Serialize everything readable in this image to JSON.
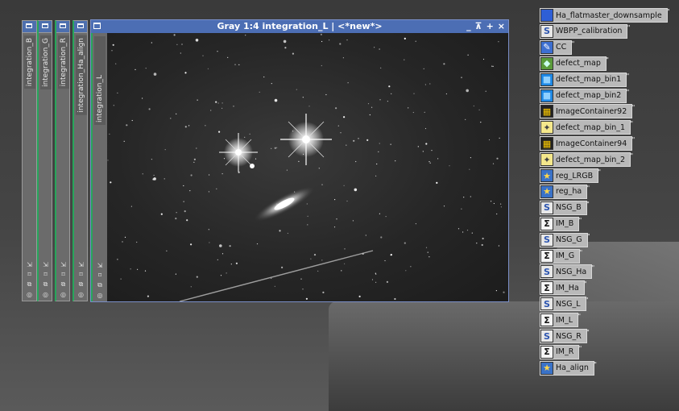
{
  "side_windows": [
    {
      "label": "integration_B"
    },
    {
      "label": "integration_G"
    },
    {
      "label": "integration_R"
    },
    {
      "label": "integration_Ha_align"
    }
  ],
  "main_window": {
    "title": "Gray 1:4 integration_L | <*new*>",
    "side_label": "integration_L",
    "controls": [
      "_",
      "⊼",
      "+",
      "×"
    ]
  },
  "tool_glyphs": [
    "⇲",
    "⌑",
    "⧉",
    "◎"
  ],
  "icons": [
    {
      "label": "Ha_flatmaster_downsample",
      "icon": "image-window-icon"
    },
    {
      "label": "WBPP_calibration",
      "icon": "process-container-icon"
    },
    {
      "label": "CC",
      "icon": "cosmetic-correction-icon"
    },
    {
      "label": "defect_map",
      "icon": "defect-map-icon"
    },
    {
      "label": "defect_map_bin1",
      "icon": "cube-icon"
    },
    {
      "label": "defect_map_bin2",
      "icon": "cube-icon"
    },
    {
      "label": "ImageContainer92",
      "icon": "image-container-icon"
    },
    {
      "label": "defect_map_bin_1",
      "icon": "script-icon"
    },
    {
      "label": "ImageContainer94",
      "icon": "image-container-icon"
    },
    {
      "label": "defect_map_bin_2",
      "icon": "script-icon"
    },
    {
      "label": "reg_LRGB",
      "icon": "star-alignment-icon"
    },
    {
      "label": "reg_ha",
      "icon": "star-alignment-icon"
    },
    {
      "label": "NSG_B",
      "icon": "process-container-icon"
    },
    {
      "label": "IM_B",
      "icon": "sigma-icon"
    },
    {
      "label": "NSG_G",
      "icon": "process-container-icon"
    },
    {
      "label": "IM_G",
      "icon": "sigma-icon"
    },
    {
      "label": "NSG_Ha",
      "icon": "process-container-icon"
    },
    {
      "label": "IM_Ha",
      "icon": "sigma-icon"
    },
    {
      "label": "NSG_L",
      "icon": "process-container-icon"
    },
    {
      "label": "IM_L",
      "icon": "sigma-icon"
    },
    {
      "label": "NSG_R",
      "icon": "process-container-icon"
    },
    {
      "label": "IM_R",
      "icon": "sigma-icon"
    },
    {
      "label": "Ha_align",
      "icon": "star-alignment-icon"
    }
  ],
  "colors": {
    "title_bar": "#4c6eb4",
    "accent_green": "#27a55a",
    "workspace": "#3f3f3f"
  }
}
